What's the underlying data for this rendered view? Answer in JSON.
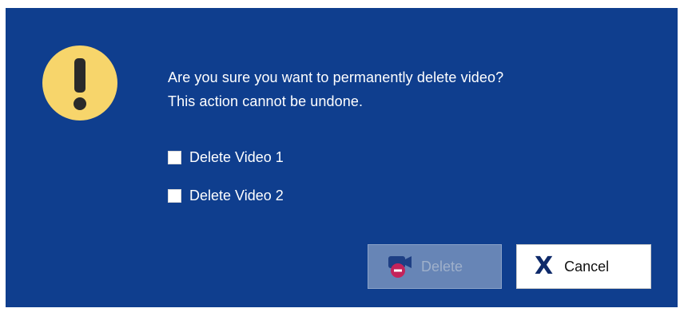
{
  "dialog": {
    "message_line1": "Are you sure you want to permanently delete video?",
    "message_line2": "This action cannot be undone.",
    "warning_icon": "warning-icon",
    "background_color": "#0f3e8e"
  },
  "options": [
    {
      "label": "Delete Video 1",
      "checked": false
    },
    {
      "label": "Delete Video 2",
      "checked": false
    }
  ],
  "buttons": {
    "delete_label": "Delete",
    "delete_enabled": false,
    "delete_icon": "delete-video-icon",
    "cancel_label": "Cancel",
    "cancel_icon": "close-icon"
  }
}
